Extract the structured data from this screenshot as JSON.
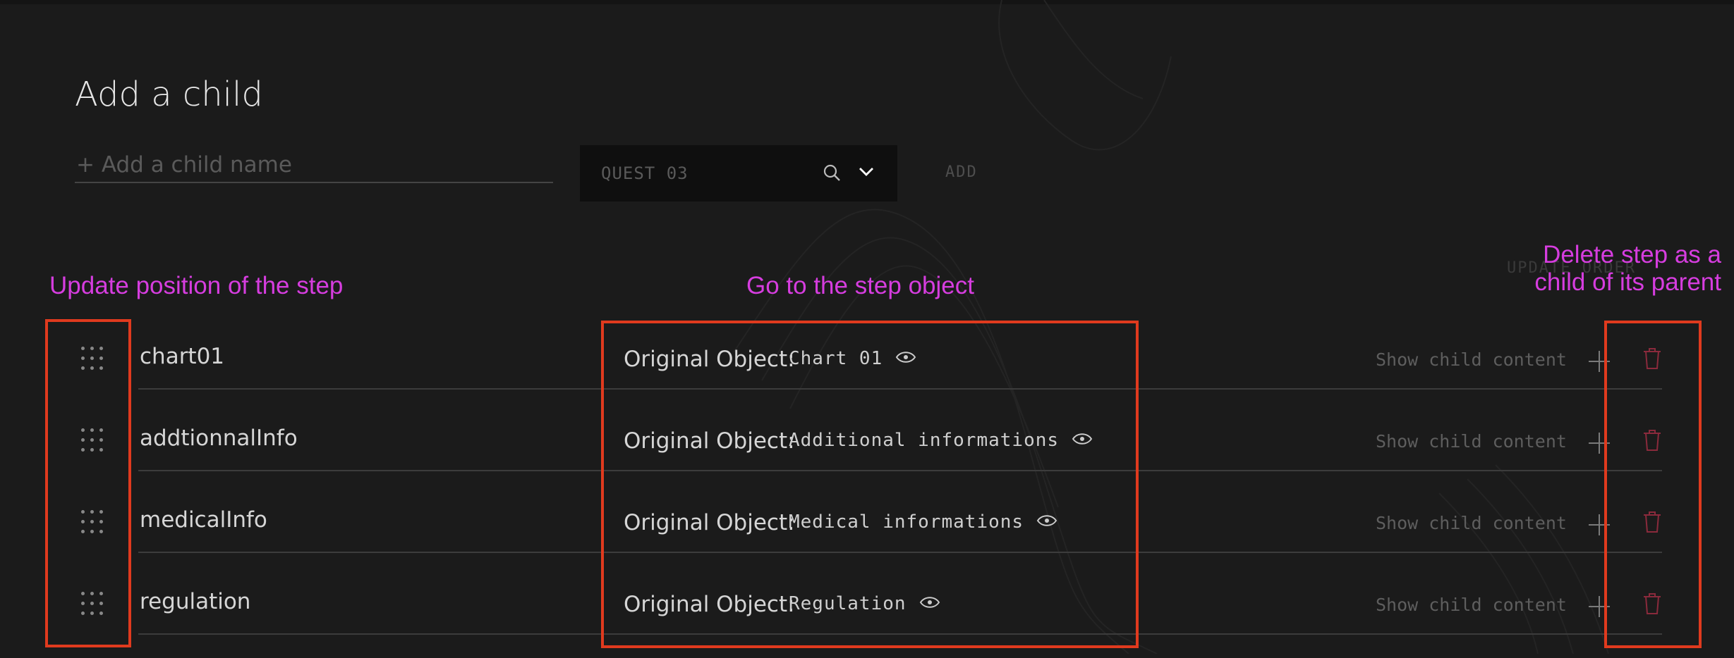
{
  "header": {
    "title": "Add a child"
  },
  "form": {
    "name_placeholder": "+ Add a child name",
    "select_value": "QUEST 03",
    "add_label": "ADD"
  },
  "list": {
    "update_order_label": "UPDATE ORDER",
    "original_object_label": "Original Object:",
    "show_child_content_label": "Show child content",
    "rows": [
      {
        "name": "chart01",
        "original_object": "Chart 01"
      },
      {
        "name": "addtionnalInfo",
        "original_object": "Additional informations"
      },
      {
        "name": "medicalInfo",
        "original_object": "Medical informations"
      },
      {
        "name": "regulation",
        "original_object": "Regulation"
      }
    ]
  },
  "annotations": {
    "drag": "Update position of the step",
    "link": "Go to the step object",
    "delete_line1": "Delete step as a",
    "delete_line2": "child of its parent"
  },
  "colors": {
    "background": "#1b1b1b",
    "annotation": "#d63ddf",
    "highlight_box": "#e03a1e",
    "delete_icon": "#8a2a3c"
  },
  "icons": [
    "search-icon",
    "chevron-down-icon",
    "drag-handle-icon",
    "eye-icon",
    "plus-icon",
    "trash-icon"
  ]
}
